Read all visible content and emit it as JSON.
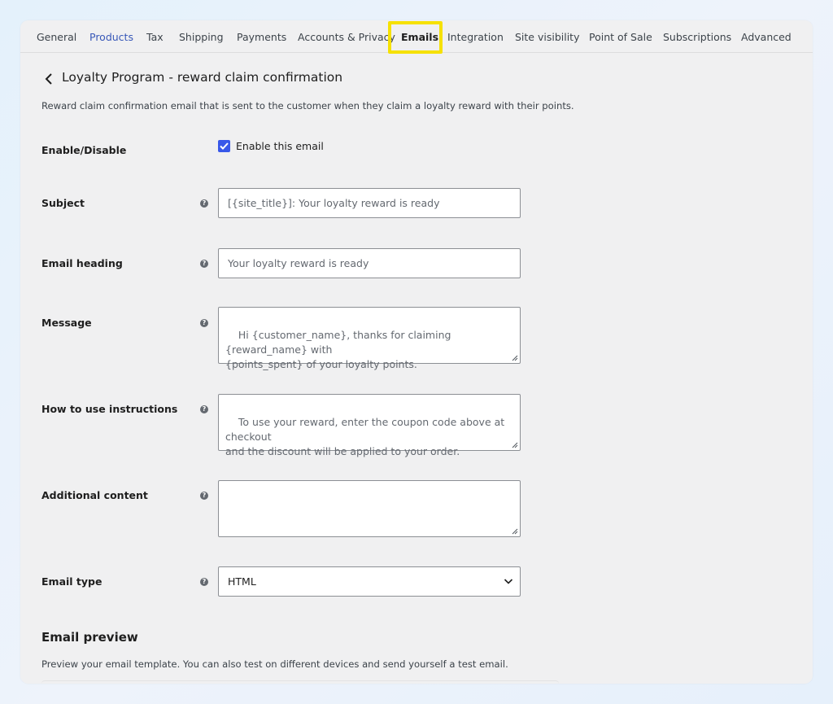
{
  "tabs": [
    {
      "label": "General"
    },
    {
      "label": "Products"
    },
    {
      "label": "Tax"
    },
    {
      "label": "Shipping"
    },
    {
      "label": "Payments"
    },
    {
      "label": "Accounts & Privacy"
    },
    {
      "label": "Emails"
    },
    {
      "label": "Integration"
    },
    {
      "label": "Site visibility"
    },
    {
      "label": "Point of Sale"
    },
    {
      "label": "Subscriptions"
    },
    {
      "label": "Advanced"
    }
  ],
  "header": {
    "title": "Loyalty Program - reward claim confirmation",
    "description": "Reward claim confirmation email that is sent to the customer when they claim a loyalty reward with their points."
  },
  "form": {
    "enable": {
      "label": "Enable/Disable",
      "checkbox_label": "Enable this email",
      "checked": true
    },
    "subject": {
      "label": "Subject",
      "placeholder": "[{site_title}]: Your loyalty reward is ready"
    },
    "heading": {
      "label": "Email heading",
      "placeholder": "Your loyalty reward is ready"
    },
    "message": {
      "label": "Message",
      "placeholder": "Hi {customer_name}, thanks for claiming {reward_name} with\n{points_spent} of your loyalty points."
    },
    "instructions": {
      "label": "How to use instructions",
      "placeholder": "To use your reward, enter the coupon code above at checkout\nand the discount will be applied to your order."
    },
    "additional": {
      "label": "Additional content",
      "placeholder": ""
    },
    "email_type": {
      "label": "Email type",
      "value": "HTML"
    }
  },
  "preview": {
    "title": "Email preview",
    "description": "Preview your email template. You can also test on different devices and send yourself a test email."
  },
  "colors": {
    "accent": "#3858e9",
    "highlight": "#f6e100",
    "link": "#3858b8"
  }
}
